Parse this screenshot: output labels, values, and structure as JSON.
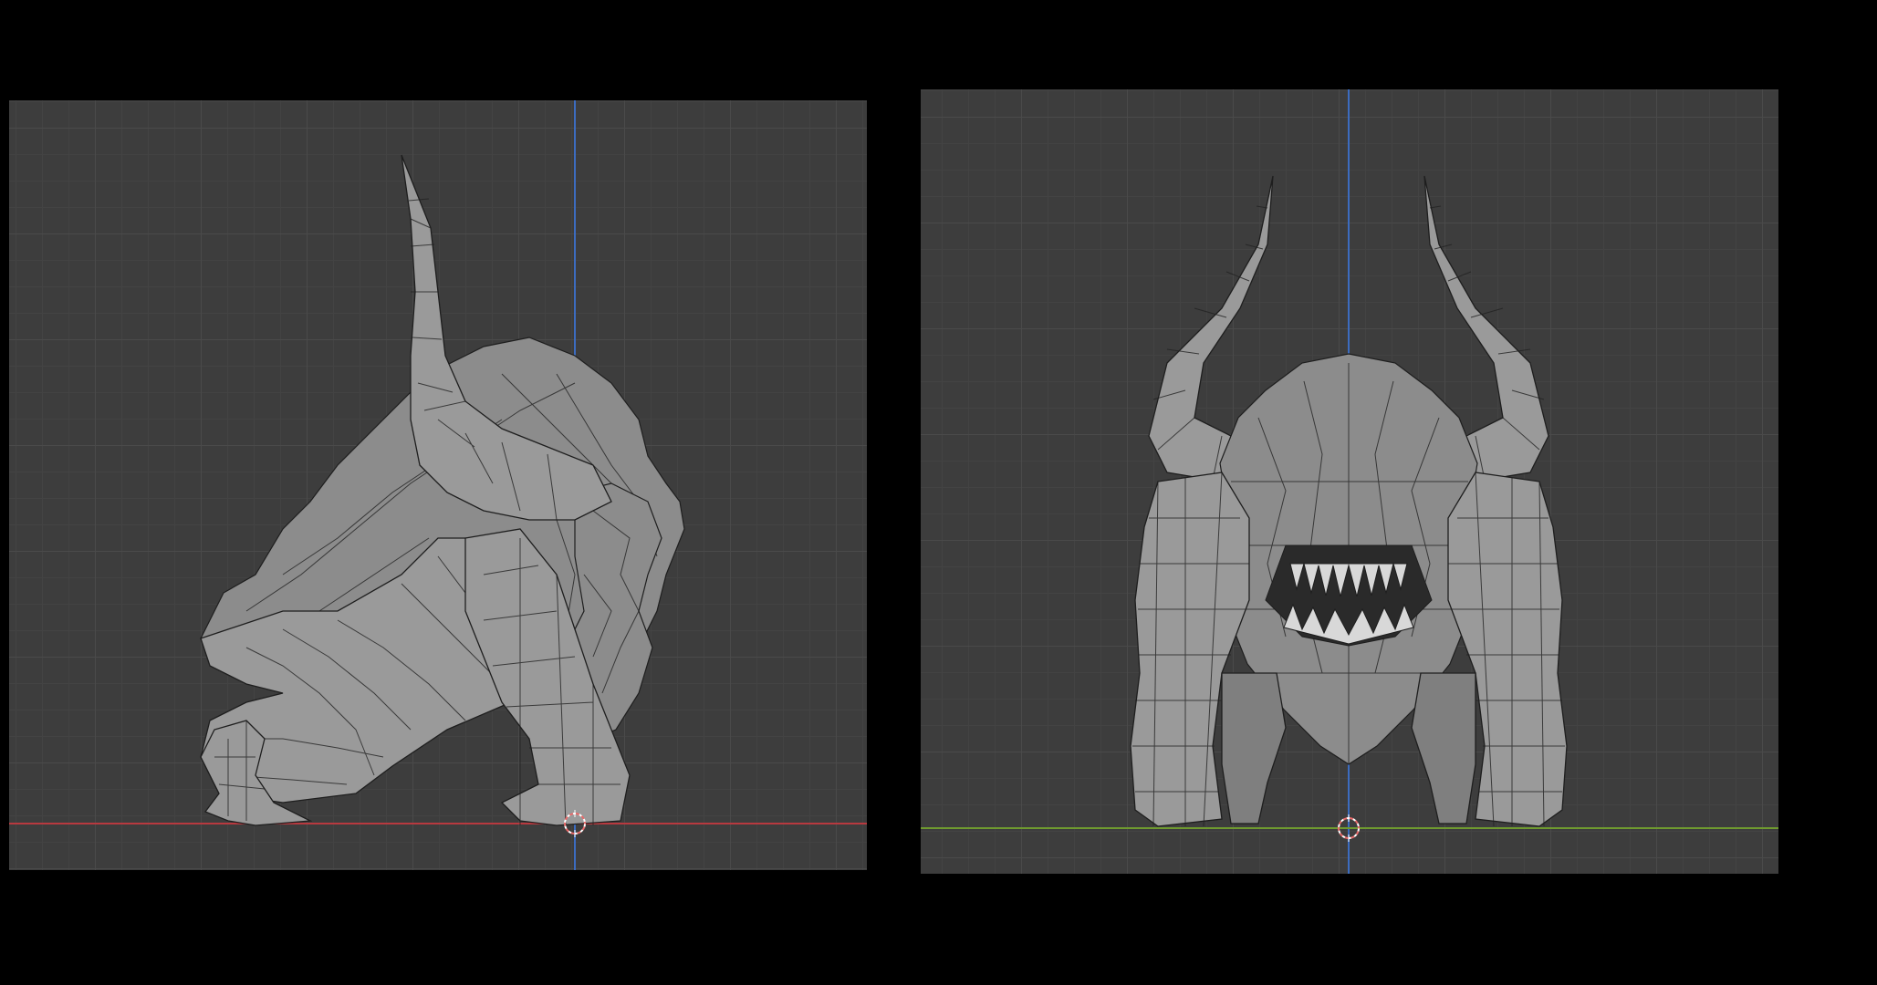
{
  "viewports": [
    {
      "view": "side",
      "object": "horned-beast-mesh",
      "shading": "solid-wireframe",
      "ground_axis": "x-axis-red",
      "vertical_axis": "z-axis-blue"
    },
    {
      "view": "front",
      "object": "horned-beast-mesh",
      "shading": "solid-wireframe",
      "ground_axis": "y-axis-green",
      "vertical_axis": "z-axis-blue"
    }
  ],
  "colors": {
    "background": "#000000",
    "viewport_bg": "#3d3d3d",
    "grid_major": "#4a4a4a",
    "grid_minor": "#434343",
    "mesh_fill": "#9a9a9a",
    "wire": "#1e1e1e",
    "x_axis": "#b8393f",
    "y_axis": "#6f9a2f",
    "z_axis": "#3c6cc0",
    "cursor_red": "#e86a6a",
    "cursor_white": "#ffffff"
  },
  "icons": [
    "3d-cursor-icon"
  ]
}
